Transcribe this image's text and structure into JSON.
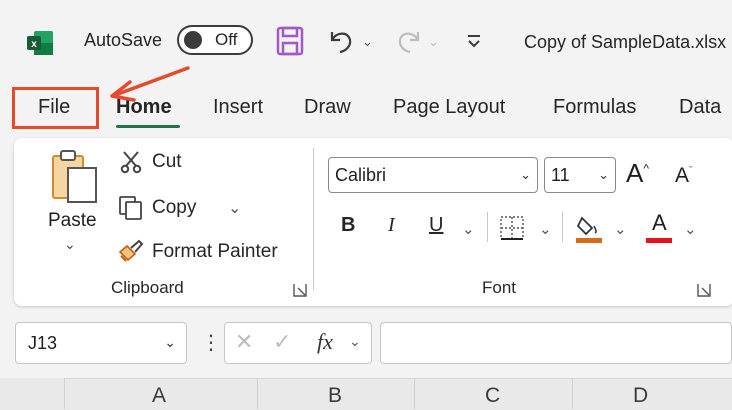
{
  "titlebar": {
    "autosave_label": "AutoSave",
    "autosave_state": "Off",
    "doc_title": "Copy of SampleData.xlsx"
  },
  "tabs": [
    {
      "label": "File"
    },
    {
      "label": "Home"
    },
    {
      "label": "Insert"
    },
    {
      "label": "Draw"
    },
    {
      "label": "Page Layout"
    },
    {
      "label": "Formulas"
    },
    {
      "label": "Data"
    }
  ],
  "ribbon": {
    "clipboard": {
      "paste_label": "Paste",
      "cut_label": "Cut",
      "copy_label": "Copy",
      "format_painter_label": "Format Painter",
      "group_label": "Clipboard"
    },
    "font": {
      "font_name": "Calibri",
      "font_size": "11",
      "bold": "B",
      "italic": "I",
      "underline": "U",
      "font_color_glyph": "A",
      "grow_glyph": "A",
      "shrink_glyph": "A",
      "group_label": "Font"
    }
  },
  "formula_bar": {
    "name_box": "J13",
    "fx_label": "fx",
    "formula_value": ""
  },
  "columns": [
    "A",
    "B",
    "C",
    "D"
  ],
  "colors": {
    "excel_green": "#217346",
    "annotation_red": "#e8492b",
    "save_purple": "#a259c4",
    "font_color_red": "#e81123",
    "fill_orange": "#d86b1a"
  }
}
